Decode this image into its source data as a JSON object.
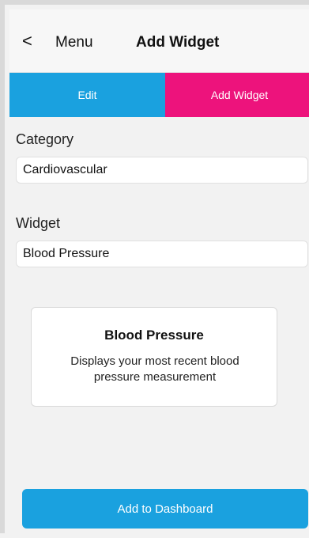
{
  "header": {
    "back_icon": "<",
    "back_label": "Menu",
    "title": "Add Widget"
  },
  "tabs": [
    {
      "label": "Edit",
      "color": "#1aa1df",
      "active": false
    },
    {
      "label": "Add Widget",
      "color": "#ed137c",
      "active": true
    }
  ],
  "form": {
    "category_label": "Category",
    "category_value": "Cardiovascular",
    "widget_label": "Widget",
    "widget_value": "Blood Pressure"
  },
  "preview": {
    "title": "Blood Pressure",
    "description": "Displays your most recent blood pressure measurement"
  },
  "actions": {
    "add_label": "Add to Dashboard",
    "add_color": "#1aa1df"
  },
  "icons": {
    "back": "chevron-left-icon"
  }
}
